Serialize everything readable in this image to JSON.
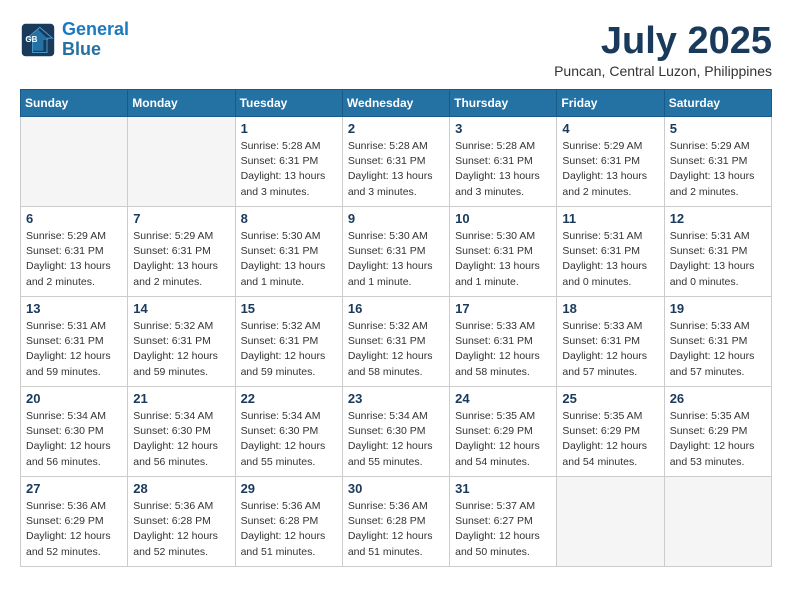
{
  "header": {
    "logo_line1": "General",
    "logo_line2": "Blue",
    "month": "July 2025",
    "location": "Puncan, Central Luzon, Philippines"
  },
  "weekdays": [
    "Sunday",
    "Monday",
    "Tuesday",
    "Wednesday",
    "Thursday",
    "Friday",
    "Saturday"
  ],
  "weeks": [
    [
      {
        "day": "",
        "info": ""
      },
      {
        "day": "",
        "info": ""
      },
      {
        "day": "1",
        "info": "Sunrise: 5:28 AM\nSunset: 6:31 PM\nDaylight: 13 hours\nand 3 minutes."
      },
      {
        "day": "2",
        "info": "Sunrise: 5:28 AM\nSunset: 6:31 PM\nDaylight: 13 hours\nand 3 minutes."
      },
      {
        "day": "3",
        "info": "Sunrise: 5:28 AM\nSunset: 6:31 PM\nDaylight: 13 hours\nand 3 minutes."
      },
      {
        "day": "4",
        "info": "Sunrise: 5:29 AM\nSunset: 6:31 PM\nDaylight: 13 hours\nand 2 minutes."
      },
      {
        "day": "5",
        "info": "Sunrise: 5:29 AM\nSunset: 6:31 PM\nDaylight: 13 hours\nand 2 minutes."
      }
    ],
    [
      {
        "day": "6",
        "info": "Sunrise: 5:29 AM\nSunset: 6:31 PM\nDaylight: 13 hours\nand 2 minutes."
      },
      {
        "day": "7",
        "info": "Sunrise: 5:29 AM\nSunset: 6:31 PM\nDaylight: 13 hours\nand 2 minutes."
      },
      {
        "day": "8",
        "info": "Sunrise: 5:30 AM\nSunset: 6:31 PM\nDaylight: 13 hours\nand 1 minute."
      },
      {
        "day": "9",
        "info": "Sunrise: 5:30 AM\nSunset: 6:31 PM\nDaylight: 13 hours\nand 1 minute."
      },
      {
        "day": "10",
        "info": "Sunrise: 5:30 AM\nSunset: 6:31 PM\nDaylight: 13 hours\nand 1 minute."
      },
      {
        "day": "11",
        "info": "Sunrise: 5:31 AM\nSunset: 6:31 PM\nDaylight: 13 hours\nand 0 minutes."
      },
      {
        "day": "12",
        "info": "Sunrise: 5:31 AM\nSunset: 6:31 PM\nDaylight: 13 hours\nand 0 minutes."
      }
    ],
    [
      {
        "day": "13",
        "info": "Sunrise: 5:31 AM\nSunset: 6:31 PM\nDaylight: 12 hours\nand 59 minutes."
      },
      {
        "day": "14",
        "info": "Sunrise: 5:32 AM\nSunset: 6:31 PM\nDaylight: 12 hours\nand 59 minutes."
      },
      {
        "day": "15",
        "info": "Sunrise: 5:32 AM\nSunset: 6:31 PM\nDaylight: 12 hours\nand 59 minutes."
      },
      {
        "day": "16",
        "info": "Sunrise: 5:32 AM\nSunset: 6:31 PM\nDaylight: 12 hours\nand 58 minutes."
      },
      {
        "day": "17",
        "info": "Sunrise: 5:33 AM\nSunset: 6:31 PM\nDaylight: 12 hours\nand 58 minutes."
      },
      {
        "day": "18",
        "info": "Sunrise: 5:33 AM\nSunset: 6:31 PM\nDaylight: 12 hours\nand 57 minutes."
      },
      {
        "day": "19",
        "info": "Sunrise: 5:33 AM\nSunset: 6:31 PM\nDaylight: 12 hours\nand 57 minutes."
      }
    ],
    [
      {
        "day": "20",
        "info": "Sunrise: 5:34 AM\nSunset: 6:30 PM\nDaylight: 12 hours\nand 56 minutes."
      },
      {
        "day": "21",
        "info": "Sunrise: 5:34 AM\nSunset: 6:30 PM\nDaylight: 12 hours\nand 56 minutes."
      },
      {
        "day": "22",
        "info": "Sunrise: 5:34 AM\nSunset: 6:30 PM\nDaylight: 12 hours\nand 55 minutes."
      },
      {
        "day": "23",
        "info": "Sunrise: 5:34 AM\nSunset: 6:30 PM\nDaylight: 12 hours\nand 55 minutes."
      },
      {
        "day": "24",
        "info": "Sunrise: 5:35 AM\nSunset: 6:29 PM\nDaylight: 12 hours\nand 54 minutes."
      },
      {
        "day": "25",
        "info": "Sunrise: 5:35 AM\nSunset: 6:29 PM\nDaylight: 12 hours\nand 54 minutes."
      },
      {
        "day": "26",
        "info": "Sunrise: 5:35 AM\nSunset: 6:29 PM\nDaylight: 12 hours\nand 53 minutes."
      }
    ],
    [
      {
        "day": "27",
        "info": "Sunrise: 5:36 AM\nSunset: 6:29 PM\nDaylight: 12 hours\nand 52 minutes."
      },
      {
        "day": "28",
        "info": "Sunrise: 5:36 AM\nSunset: 6:28 PM\nDaylight: 12 hours\nand 52 minutes."
      },
      {
        "day": "29",
        "info": "Sunrise: 5:36 AM\nSunset: 6:28 PM\nDaylight: 12 hours\nand 51 minutes."
      },
      {
        "day": "30",
        "info": "Sunrise: 5:36 AM\nSunset: 6:28 PM\nDaylight: 12 hours\nand 51 minutes."
      },
      {
        "day": "31",
        "info": "Sunrise: 5:37 AM\nSunset: 6:27 PM\nDaylight: 12 hours\nand 50 minutes."
      },
      {
        "day": "",
        "info": ""
      },
      {
        "day": "",
        "info": ""
      }
    ]
  ]
}
